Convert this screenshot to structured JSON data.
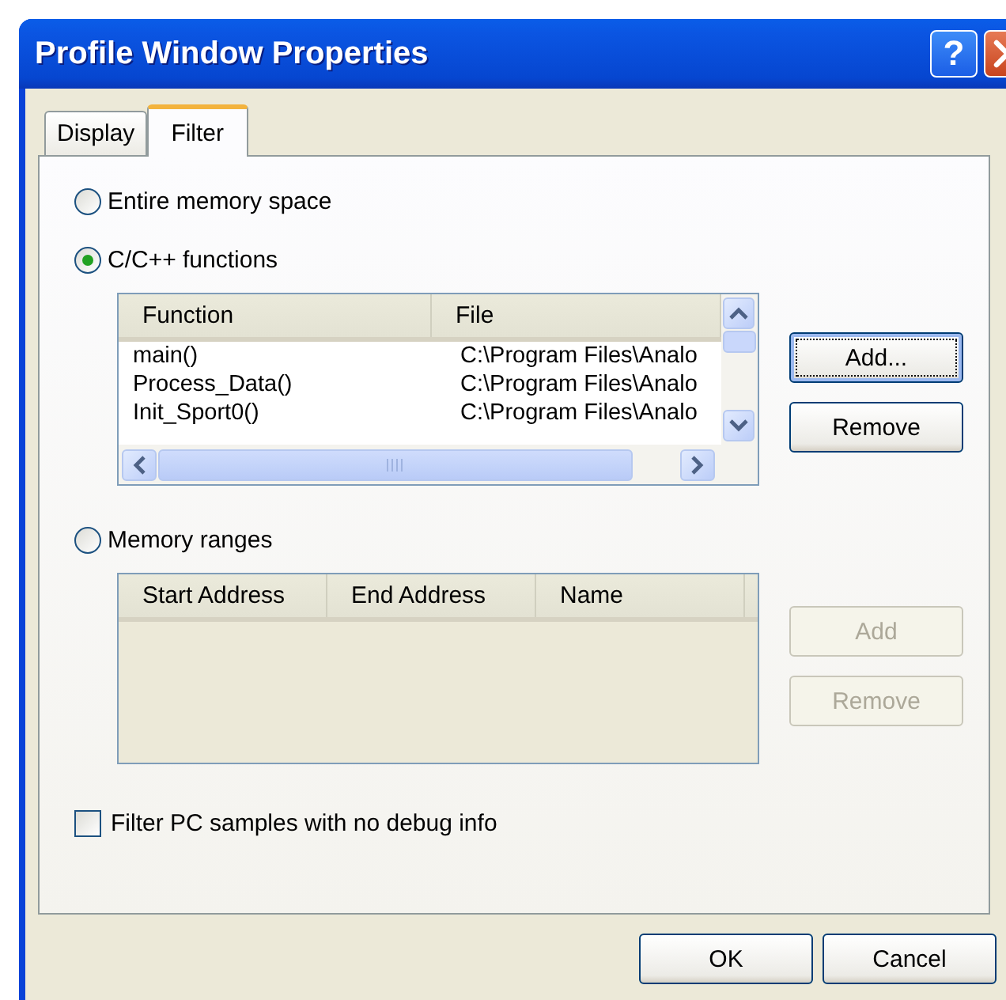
{
  "window": {
    "title": "Profile Window Properties",
    "help": "?"
  },
  "tabs": [
    {
      "label": "Display",
      "selected": false
    },
    {
      "label": "Filter",
      "selected": true
    }
  ],
  "options": [
    {
      "label": "Entire memory space",
      "selected": false
    },
    {
      "label": "C/C++ functions",
      "selected": true
    },
    {
      "label": "Memory ranges",
      "selected": false
    }
  ],
  "functions_table": {
    "columns": [
      "Function",
      "File"
    ],
    "rows": [
      {
        "function": "main()",
        "file": "C:\\Program Files\\Analo"
      },
      {
        "function": "Process_Data()",
        "file": "C:\\Program Files\\Analo"
      },
      {
        "function": "Init_Sport0()",
        "file": "C:\\Program Files\\Analo"
      }
    ],
    "buttons": [
      {
        "label": "Add...",
        "disabled": false
      },
      {
        "label": "Remove",
        "disabled": false
      }
    ]
  },
  "ranges_table": {
    "columns": [
      "Start Address",
      "End Address",
      "Name"
    ],
    "buttons": [
      {
        "label": "Add",
        "disabled": true
      },
      {
        "label": "Remove",
        "disabled": true
      }
    ]
  },
  "filter_checkbox": {
    "label": "Filter PC samples with no debug info",
    "checked": false
  },
  "buttons": [
    "OK",
    "Cancel"
  ]
}
